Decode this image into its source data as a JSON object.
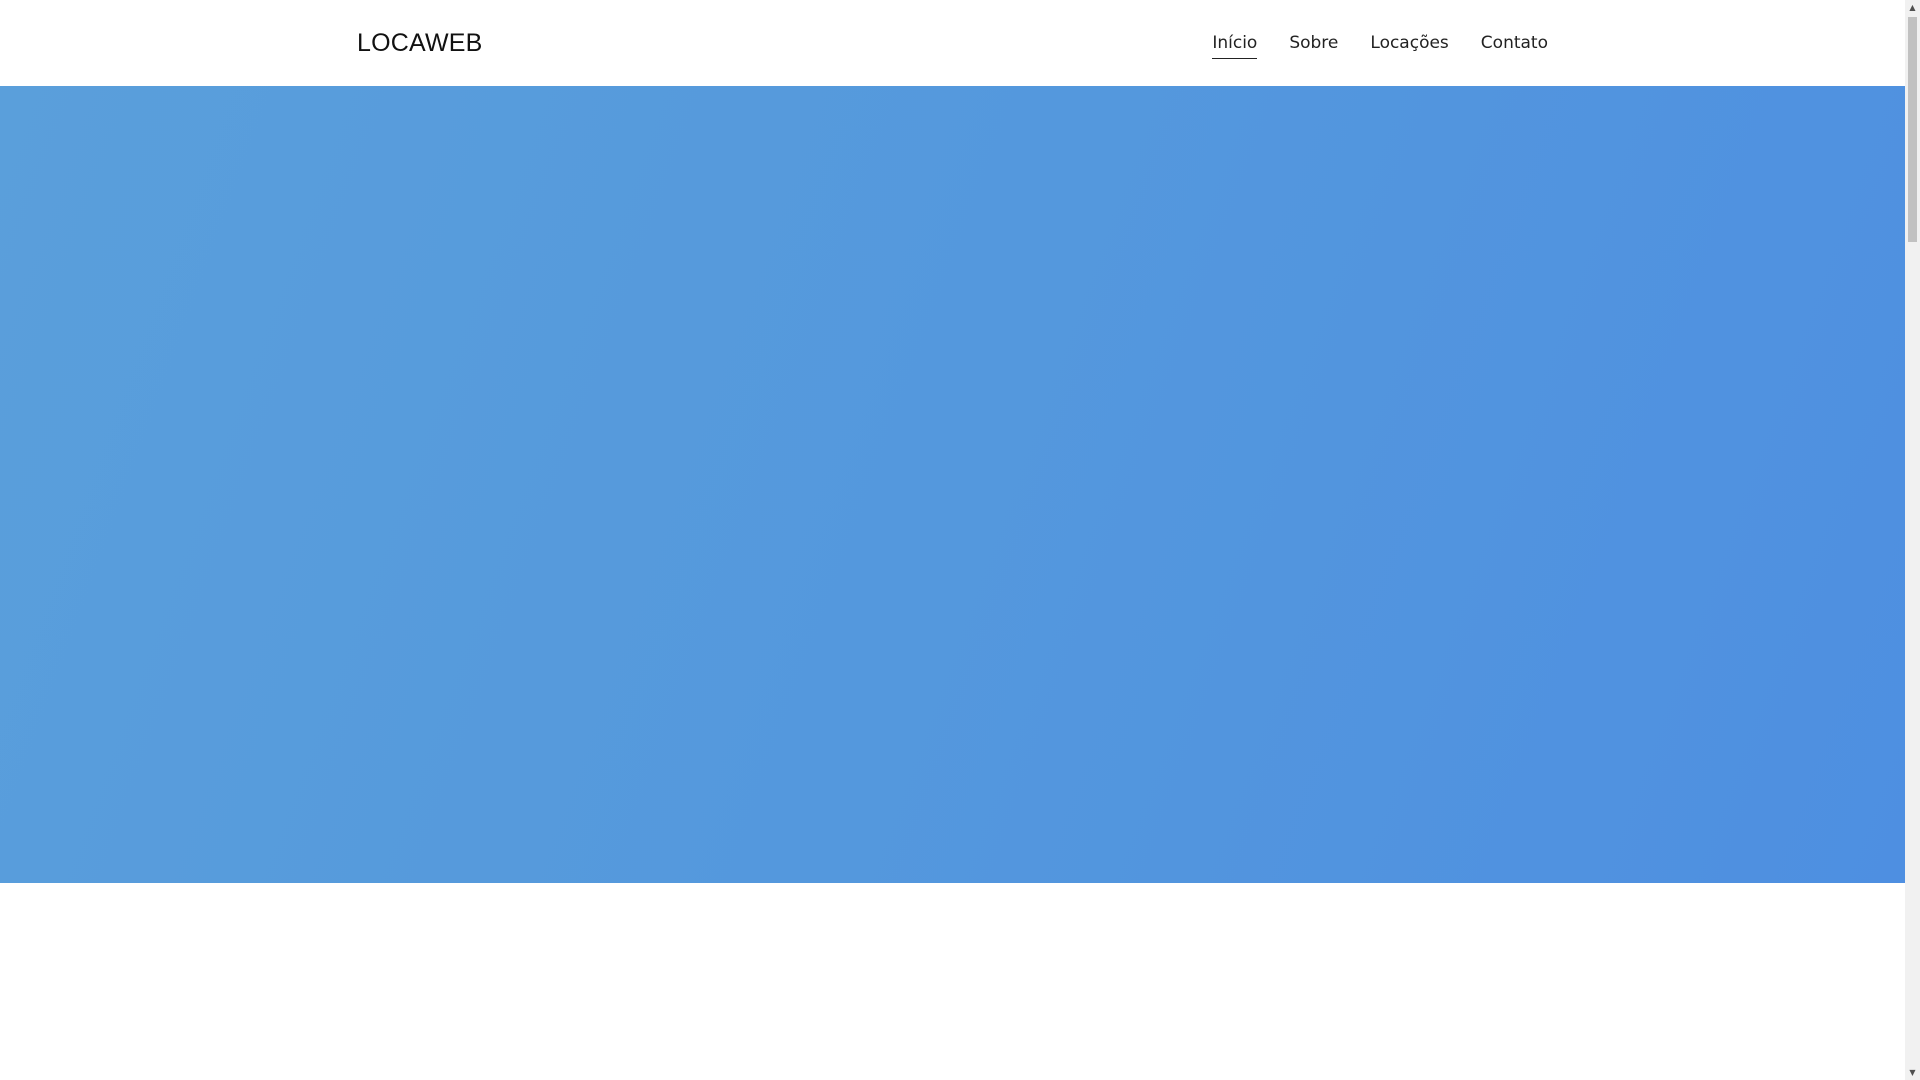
{
  "navbar": {
    "brand": "LOCAWEB",
    "links": [
      {
        "label": "Início",
        "active": true
      },
      {
        "label": "Sobre",
        "active": false
      },
      {
        "label": "Locações",
        "active": false
      },
      {
        "label": "Contato",
        "active": false
      }
    ]
  },
  "hero": {
    "gradient_colors": [
      "#5a9fdb",
      "#5498dd",
      "#4e8fe1"
    ]
  },
  "scrollbar": {
    "up_icon": "triangle-up-icon",
    "down_icon": "triangle-down-icon",
    "up_glyph": "▲",
    "down_glyph": "▼"
  }
}
